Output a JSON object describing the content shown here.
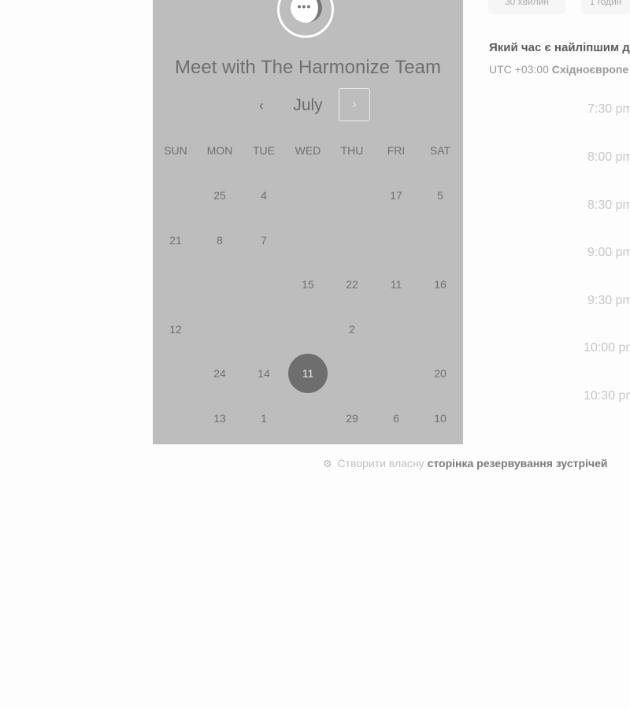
{
  "header": {
    "title": "Meet with The Harmonize Team"
  },
  "calendar": {
    "month": "July",
    "prev_icon": "‹",
    "next_icon": "›",
    "weekdays": [
      "SUN",
      "MON",
      "TUE",
      "WED",
      "THU",
      "FRI",
      "SAT"
    ],
    "days": [
      "",
      "25",
      "4",
      "",
      "",
      "17",
      "5",
      "21",
      "8",
      "7",
      "",
      "",
      "",
      "",
      "",
      "",
      "",
      "15",
      "22",
      "11",
      "16",
      "12",
      "",
      "",
      "",
      "2",
      "",
      "",
      "",
      "24",
      "14",
      "11",
      "",
      "",
      "20",
      "",
      "13",
      "1",
      "",
      "29",
      "6",
      "10"
    ],
    "selected_day": "11",
    "selected_index": 31
  },
  "durations": [
    "30 хвилин",
    "1 годин"
  ],
  "scheduler": {
    "question": "Який час є найліпшим д",
    "timezone_offset": "UTC +03:00",
    "timezone_name": "Східноєвропе",
    "slots": [
      "7:30 pm",
      "8:00 pm",
      "8:30 pm",
      "9:00 pm",
      "9:30 pm",
      "10:00 pm",
      "10:30 pm"
    ]
  },
  "footer": {
    "prefix": "Створити власну",
    "link": "сторінка резервування зустрічей"
  }
}
